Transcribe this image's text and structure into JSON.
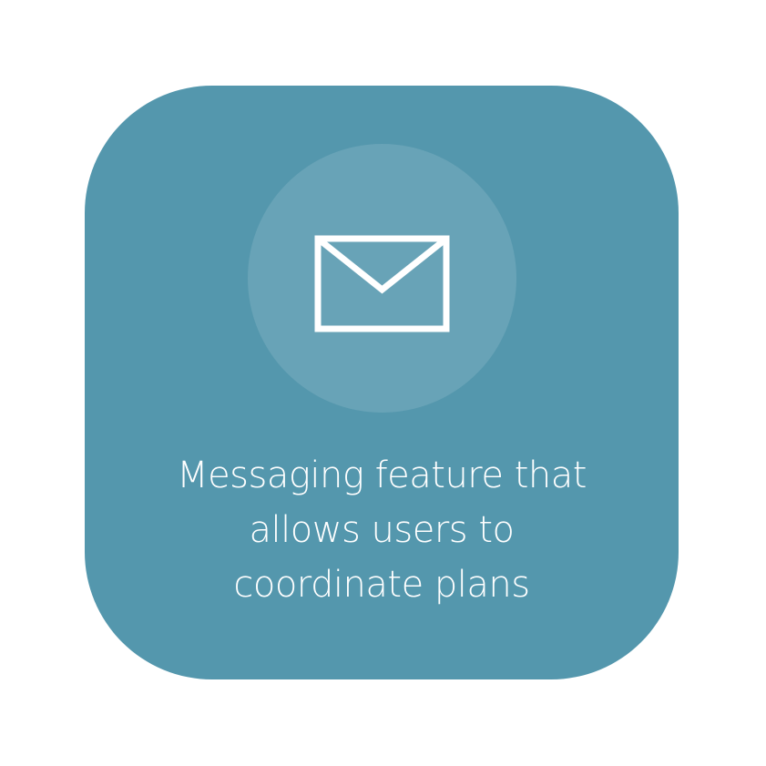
{
  "feature": {
    "icon": "envelope-icon",
    "lines": [
      "Messaging feature that",
      "allows users to",
      "coordinate plans"
    ]
  },
  "colors": {
    "card_background": "#5497ad",
    "icon_circle": "rgba(255,255,255,0.12)",
    "foreground": "#ffffff",
    "page_background": "#ffffff"
  }
}
